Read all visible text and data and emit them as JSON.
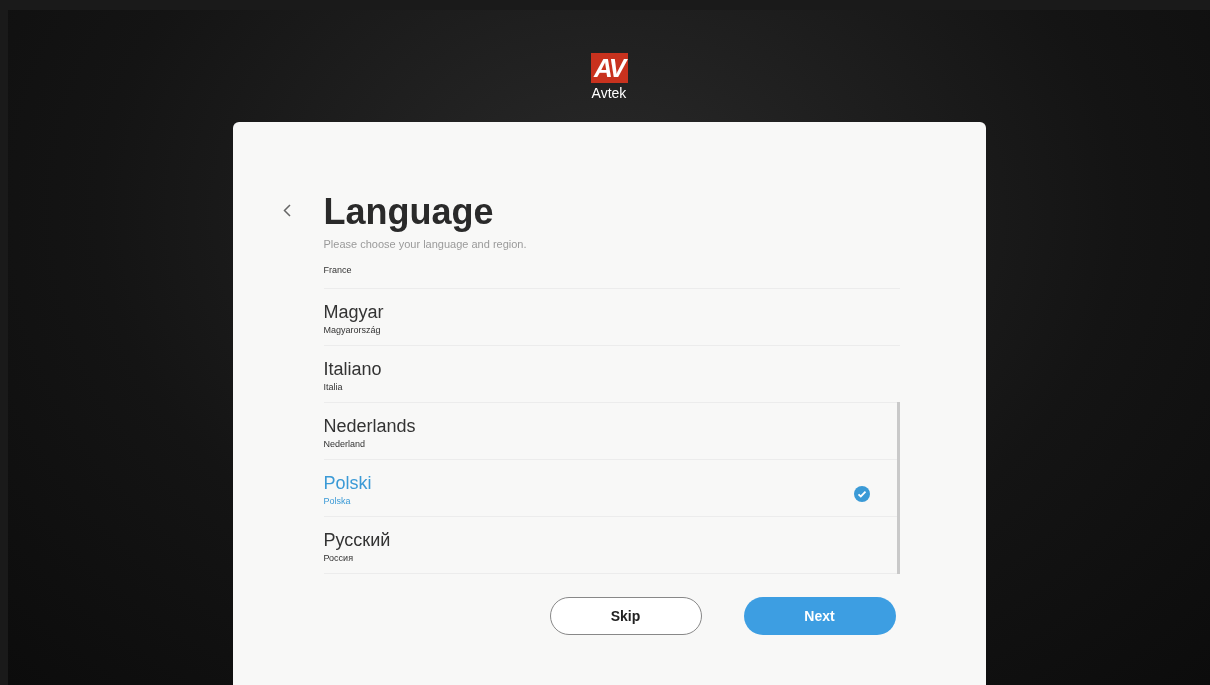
{
  "logo": {
    "mark": "AV",
    "name": "Avtek"
  },
  "header": {
    "title": "Language",
    "subtitle": "Please choose your language and region."
  },
  "languages": [
    {
      "region": "France",
      "selected": false,
      "partial": true
    },
    {
      "name": "Magyar",
      "region": "Magyarország",
      "selected": false
    },
    {
      "name": "Italiano",
      "region": "Italia",
      "selected": false
    },
    {
      "name": "Nederlands",
      "region": "Nederland",
      "selected": false
    },
    {
      "name": "Polski",
      "region": "Polska",
      "selected": true
    },
    {
      "name": "Русский",
      "region": "Россия",
      "selected": false
    }
  ],
  "buttons": [
    {
      "label": "Skip",
      "kind": "secondary"
    },
    {
      "label": "Next",
      "kind": "primary"
    }
  ]
}
